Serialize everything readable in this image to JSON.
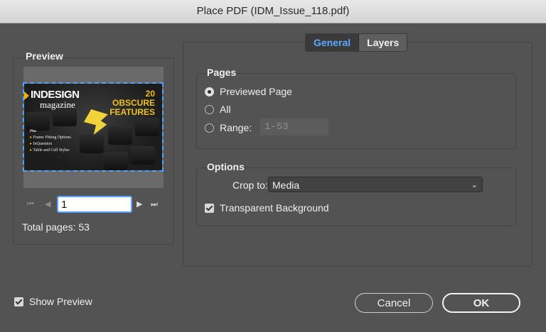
{
  "window": {
    "title": "Place PDF (IDM_Issue_118.pdf)"
  },
  "preview": {
    "group_label": "Preview",
    "thumbnail": {
      "brand_top": "INDESIGN",
      "brand_bottom": "magazine",
      "headline": "20 OBSCURE FEATURES",
      "toc_header": "Plus",
      "toc_items": [
        "Frame Fitting Options",
        "InQuestion",
        "Table and Cell Styles"
      ],
      "accent_color": "#f0c020",
      "selection_color": "#4da3ff"
    },
    "pager": {
      "first_icon": "first-page-icon",
      "prev_icon": "prev-page-icon",
      "next_icon": "next-page-icon",
      "last_icon": "last-page-icon",
      "current_page": "1"
    },
    "total_pages_text": "Total pages: 53"
  },
  "tabs": [
    {
      "label": "General",
      "active": true
    },
    {
      "label": "Layers",
      "active": false
    }
  ],
  "pages_group": {
    "label": "Pages",
    "options": [
      {
        "label": "Previewed Page",
        "selected": true
      },
      {
        "label": "All",
        "selected": false
      },
      {
        "label": "Range:",
        "selected": false
      }
    ],
    "range_value": "1-53"
  },
  "options_group": {
    "label": "Options",
    "crop_label": "Crop to:",
    "crop_value": "Media",
    "transparent_background_label": "Transparent Background",
    "transparent_background_checked": true
  },
  "footer": {
    "show_preview_label": "Show Preview",
    "show_preview_checked": true,
    "cancel_label": "Cancel",
    "ok_label": "OK"
  }
}
